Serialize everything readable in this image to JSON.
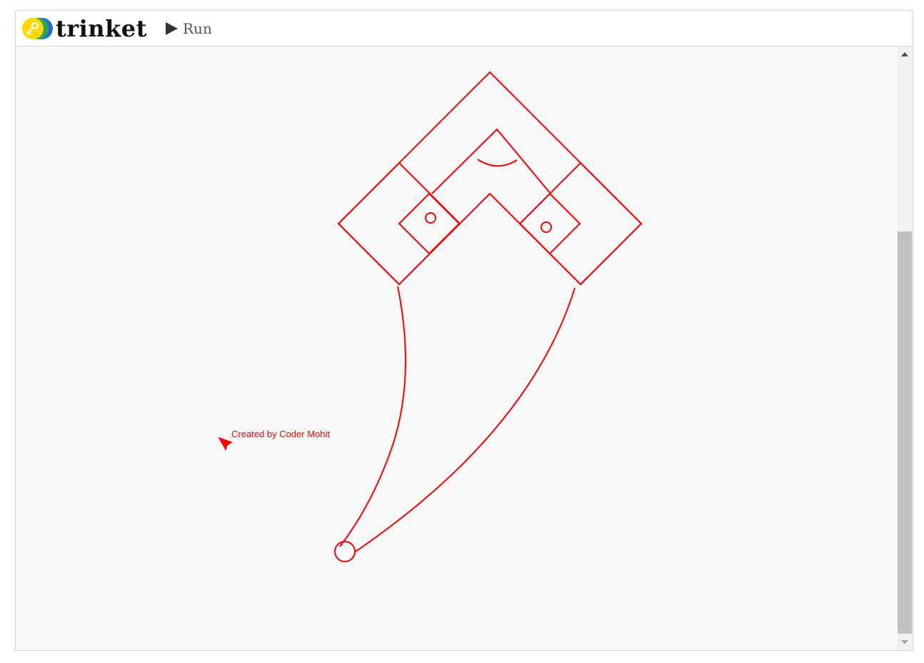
{
  "header": {
    "logo_text": "trinket",
    "logo_icon": "trinket-key-icon",
    "run_label": "Run",
    "run_icon": "play-icon"
  },
  "canvas": {
    "credit_text": "Created by Coder Mohit",
    "turtle_icon": "turtle-arrow-icon",
    "stroke_color": "#ff0000",
    "background_color": "#f8f8f8"
  },
  "scrollbar": {
    "up_icon": "scroll-up-arrow-icon",
    "down_icon": "scroll-down-arrow-icon"
  },
  "colors": {
    "logo_yellow": "#ffd800",
    "logo_green": "#2aa84a",
    "logo_blue": "#1e6fd9",
    "drawing": "#ff0000"
  }
}
